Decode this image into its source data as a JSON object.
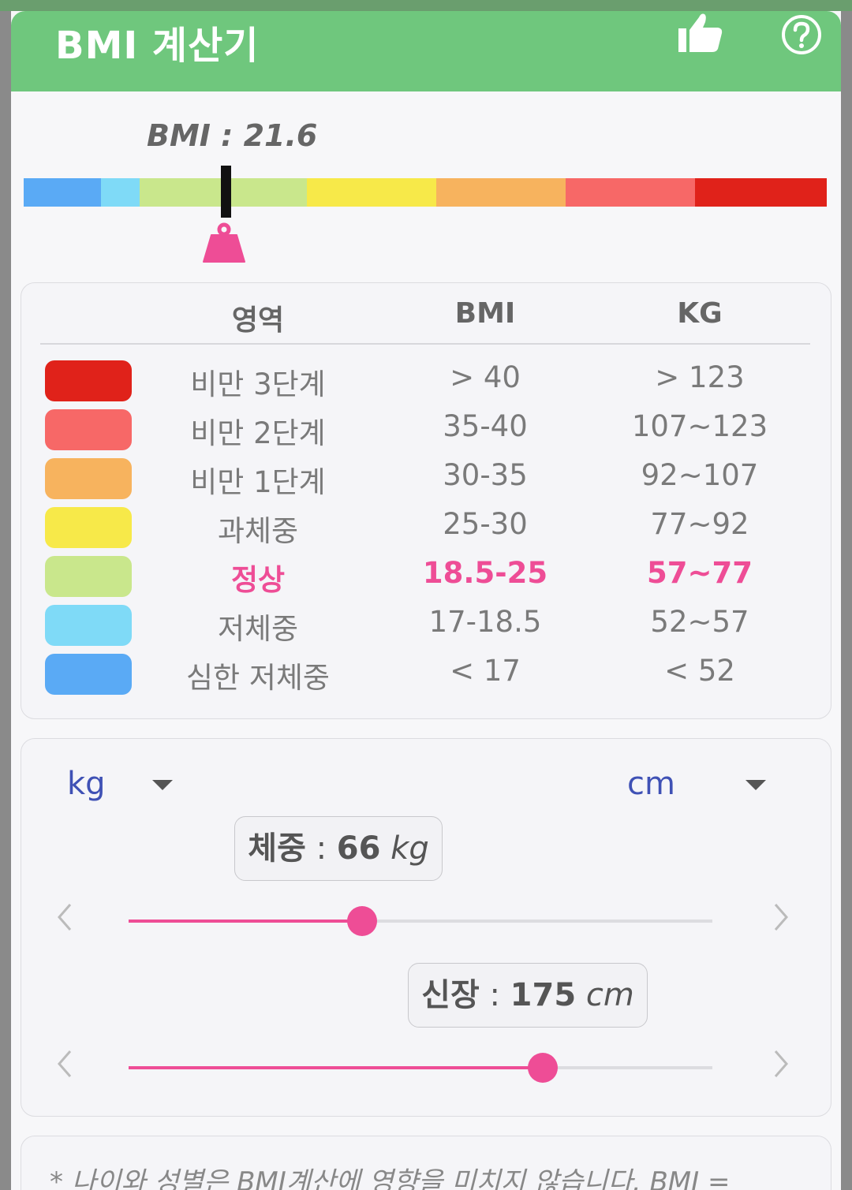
{
  "app": {
    "title": "BMI 계산기"
  },
  "icons": {
    "like": "thumbs-up-icon",
    "help": "help-icon",
    "weight": "weight-icon"
  },
  "colors": {
    "appbar": "#6fc77d",
    "accent": "#ee4d96",
    "unit_text": "#3f51b5"
  },
  "bmi": {
    "label": "BMI : 21.6",
    "value": 21.6
  },
  "scale_segments": [
    {
      "color": "#5aaaf5"
    },
    {
      "color": "#7fdaf7"
    },
    {
      "color": "#c9e78c"
    },
    {
      "color": "#f7e949"
    },
    {
      "color": "#f7b35e"
    },
    {
      "color": "#f76867"
    },
    {
      "color": "#e0221a"
    }
  ],
  "table": {
    "headers": {
      "area": "영역",
      "bmi": "BMI",
      "kg": "KG"
    },
    "rows": [
      {
        "area": "비만 3단계",
        "bmi": "> 40",
        "kg": "> 123",
        "color": "#e0221a"
      },
      {
        "area": "비만 2단계",
        "bmi": "35-40",
        "kg": "107~123",
        "color": "#f76867"
      },
      {
        "area": "비만 1단계",
        "bmi": "30-35",
        "kg": "92~107",
        "color": "#f7b35e"
      },
      {
        "area": "과체중",
        "bmi": "25-30",
        "kg": "77~92",
        "color": "#f7e949"
      },
      {
        "area": "정상",
        "bmi": "18.5-25",
        "kg": "57~77",
        "color": "#c9e78c",
        "highlight": true
      },
      {
        "area": "저체중",
        "bmi": "17-18.5",
        "kg": "52~57",
        "color": "#7fdaf7"
      },
      {
        "area": "심한 저체중",
        "bmi": "< 17",
        "kg": "< 52",
        "color": "#5aaaf5"
      }
    ]
  },
  "units": {
    "weight": "kg",
    "height": "cm"
  },
  "weight": {
    "label": "체중",
    "sep": " : ",
    "value": "66",
    "unit": " kg",
    "slider_fraction": 0.4
  },
  "height": {
    "label": "신장",
    "sep": " : ",
    "value": "175",
    "unit": " cm",
    "slider_fraction": 0.71
  },
  "footnote": "* 나이와 성별은 BMI계산에 영향을 미치지 않습니다. BMI ="
}
